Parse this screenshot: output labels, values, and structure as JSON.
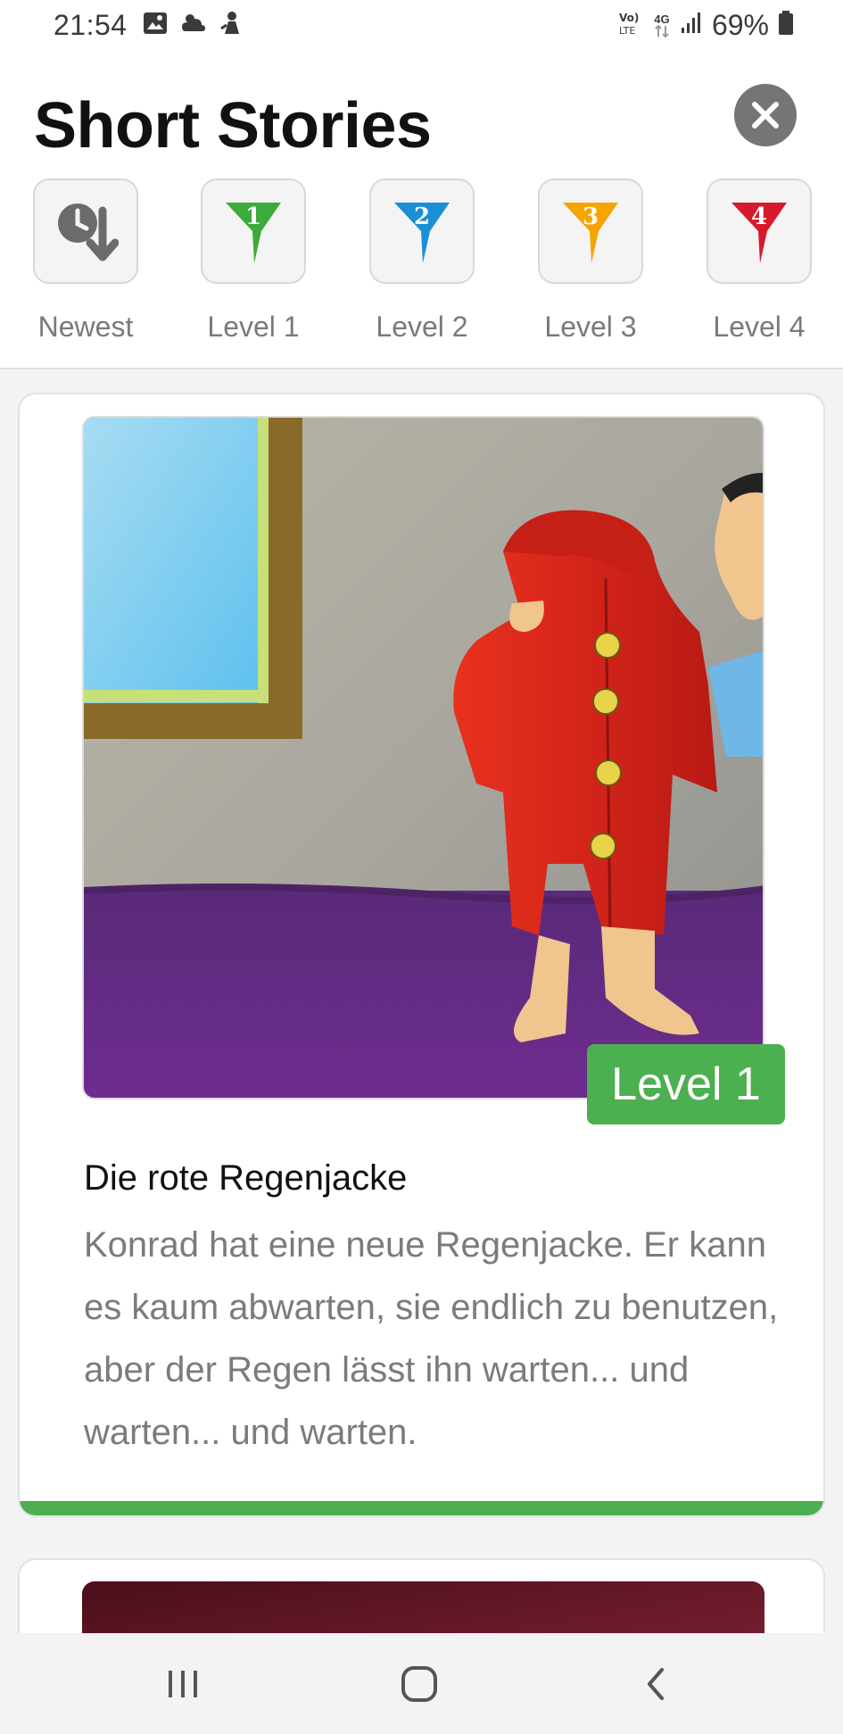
{
  "status_bar": {
    "time": "21:54",
    "network_text": "4G",
    "battery": "69%"
  },
  "header": {
    "title": "Short Stories"
  },
  "filters": [
    {
      "label": "Newest",
      "icon": "clock-sort-icon"
    },
    {
      "label": "Level 1",
      "icon": "level-1-filter-icon",
      "color": "#3cab3c",
      "number": "1"
    },
    {
      "label": "Level 2",
      "icon": "level-2-filter-icon",
      "color": "#1b8fd6",
      "number": "2"
    },
    {
      "label": "Level 3",
      "icon": "level-3-filter-icon",
      "color": "#f5a400",
      "number": "3"
    },
    {
      "label": "Level 4",
      "icon": "level-4-filter-icon",
      "color": "#d6192b",
      "number": "4"
    }
  ],
  "stories": [
    {
      "level_badge": "Level 1",
      "title": "Die rote Regenjacke",
      "description": "Konrad hat eine neue Regenjacke. Er kann es kaum abwarten, sie endlich zu benutzen, aber der Regen lässt ihn warten... und warten... und warten.",
      "accent_color": "#4caf50"
    }
  ],
  "colors": {
    "level_green": "#4caf50",
    "close_button": "#757575"
  }
}
